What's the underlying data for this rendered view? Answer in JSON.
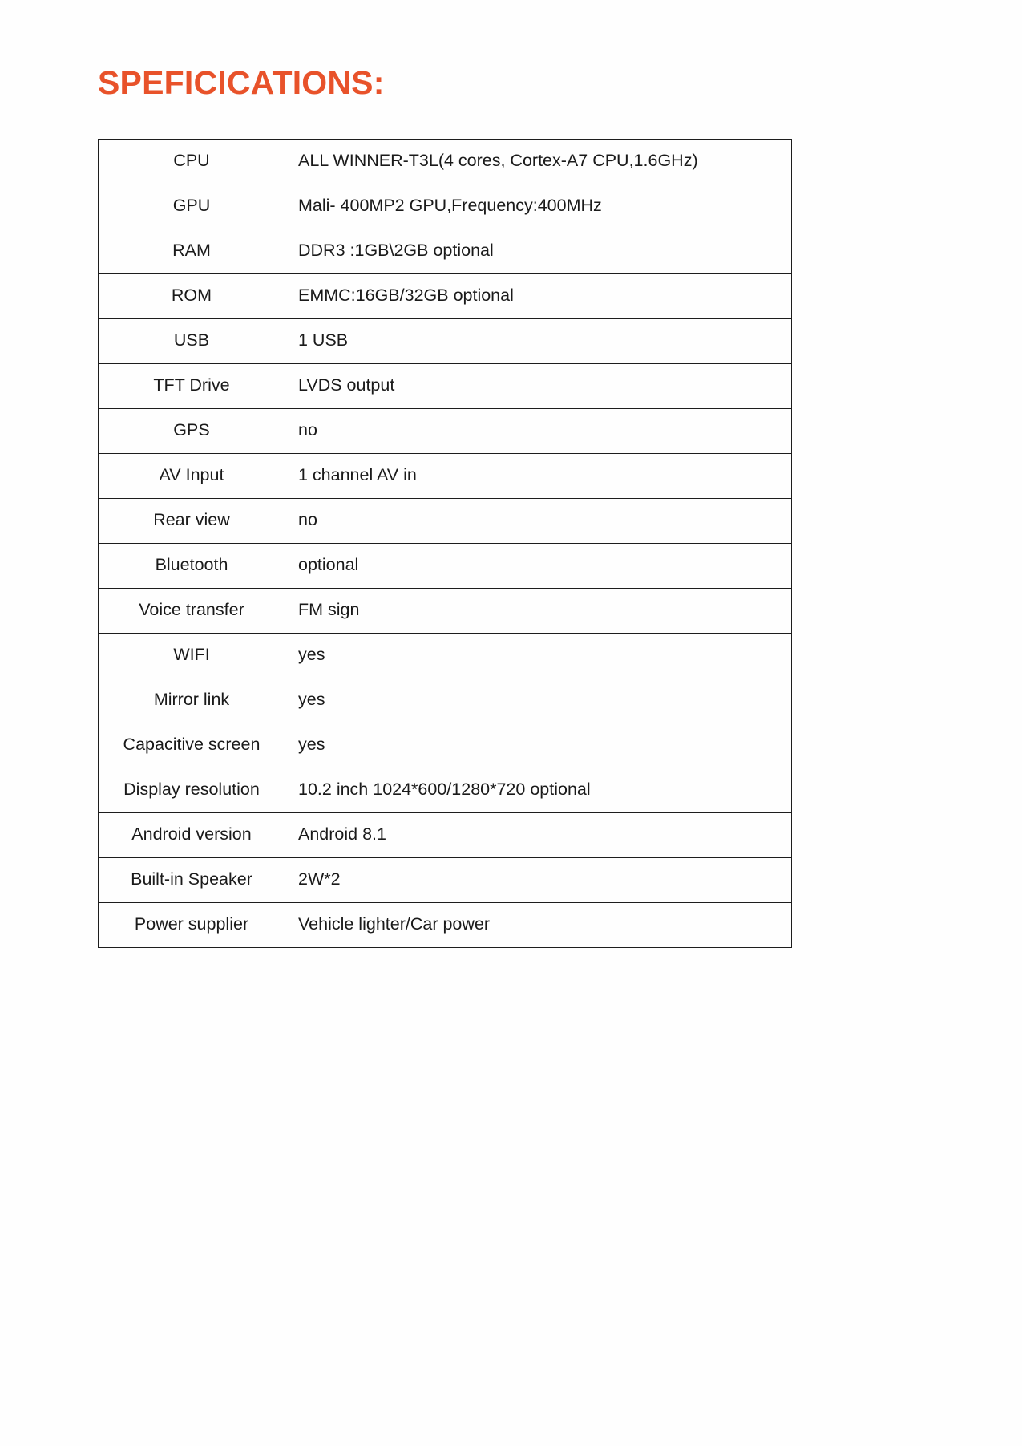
{
  "document": {
    "title": "SPEFICICATIONS:",
    "title_color": "#e8522a",
    "background_color": "#ffffff"
  },
  "spec_table": {
    "rows": [
      {
        "label": "CPU",
        "value": "ALL WINNER-T3L(4 cores, Cortex-A7 CPU,1.6GHz)"
      },
      {
        "label": "GPU",
        "value": "Mali-  400MP2 GPU,Frequency:400MHz"
      },
      {
        "label": "RAM",
        "value": "DDR3 :1GB\\2GB optional"
      },
      {
        "label": "ROM",
        "value": "EMMC:16GB/32GB optional"
      },
      {
        "label": "USB",
        "value": "1 USB"
      },
      {
        "label": "TFT Drive",
        "value": "LVDS output"
      },
      {
        "label": "GPS",
        "value": "no"
      },
      {
        "label": "AV Input",
        "value": "1 channel AV in"
      },
      {
        "label": "Rear view",
        "value": "no"
      },
      {
        "label": "Bluetooth",
        "value": "optional"
      },
      {
        "label": "Voice transfer",
        "value": "FM sign"
      },
      {
        "label": "WIFI",
        "value": "yes"
      },
      {
        "label": "Mirror link",
        "value": "yes"
      },
      {
        "label": "Capacitive screen",
        "value": "yes"
      },
      {
        "label": "Display resolution",
        "value": "10.2 inch 1024*600/1280*720 optional"
      },
      {
        "label": "Android version",
        "value": "Android 8.1"
      },
      {
        "label": "Built-in Speaker",
        "value": "2W*2"
      },
      {
        "label": "Power supplier",
        "value": "Vehicle lighter/Car power"
      }
    ]
  }
}
